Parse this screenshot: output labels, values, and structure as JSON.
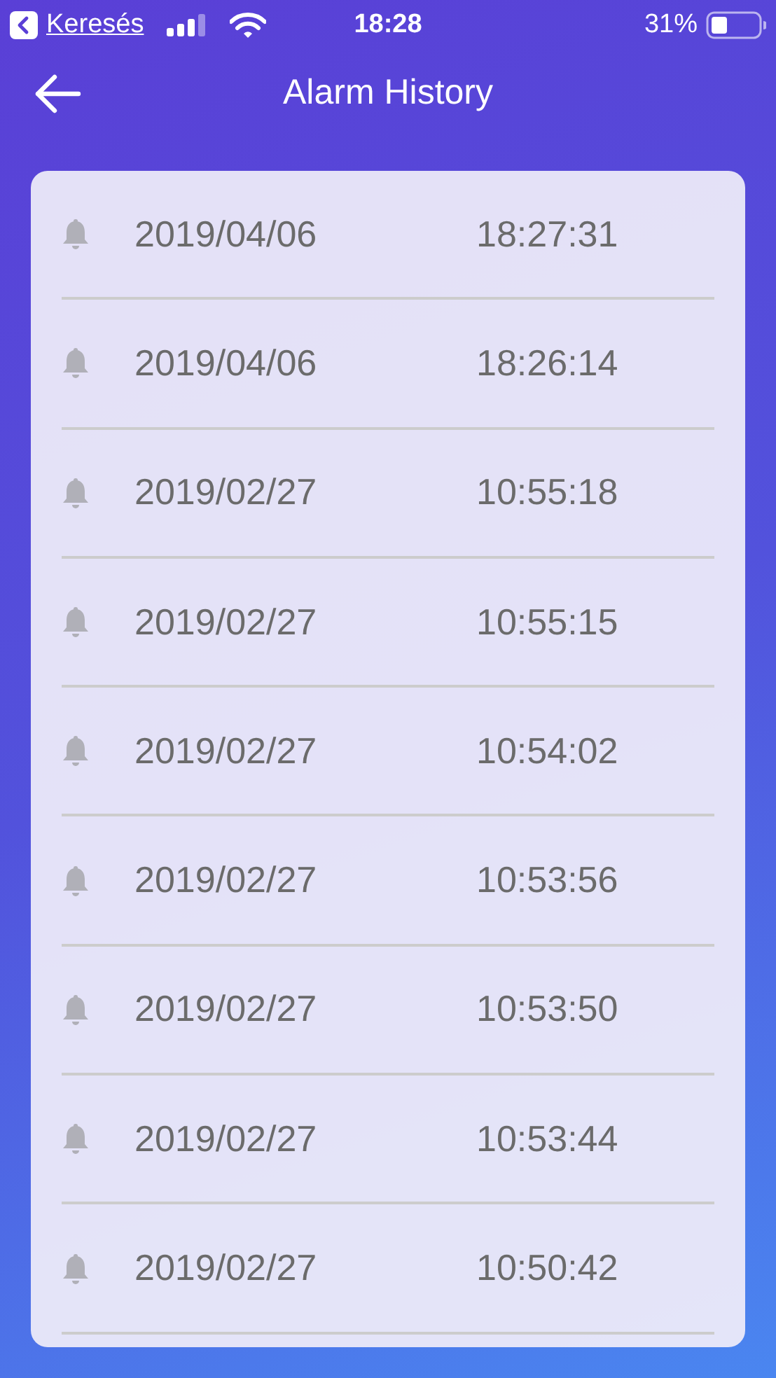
{
  "status_bar": {
    "back_app": "Keresés",
    "time": "18:28",
    "battery": "31%"
  },
  "header": {
    "title": "Alarm History"
  },
  "alarms": [
    {
      "date": "2019/04/06",
      "time": "18:27:31"
    },
    {
      "date": "2019/04/06",
      "time": "18:26:14"
    },
    {
      "date": "2019/02/27",
      "time": "10:55:18"
    },
    {
      "date": "2019/02/27",
      "time": "10:55:15"
    },
    {
      "date": "2019/02/27",
      "time": "10:54:02"
    },
    {
      "date": "2019/02/27",
      "time": "10:53:56"
    },
    {
      "date": "2019/02/27",
      "time": "10:53:50"
    },
    {
      "date": "2019/02/27",
      "time": "10:53:44"
    },
    {
      "date": "2019/02/27",
      "time": "10:50:42"
    }
  ]
}
